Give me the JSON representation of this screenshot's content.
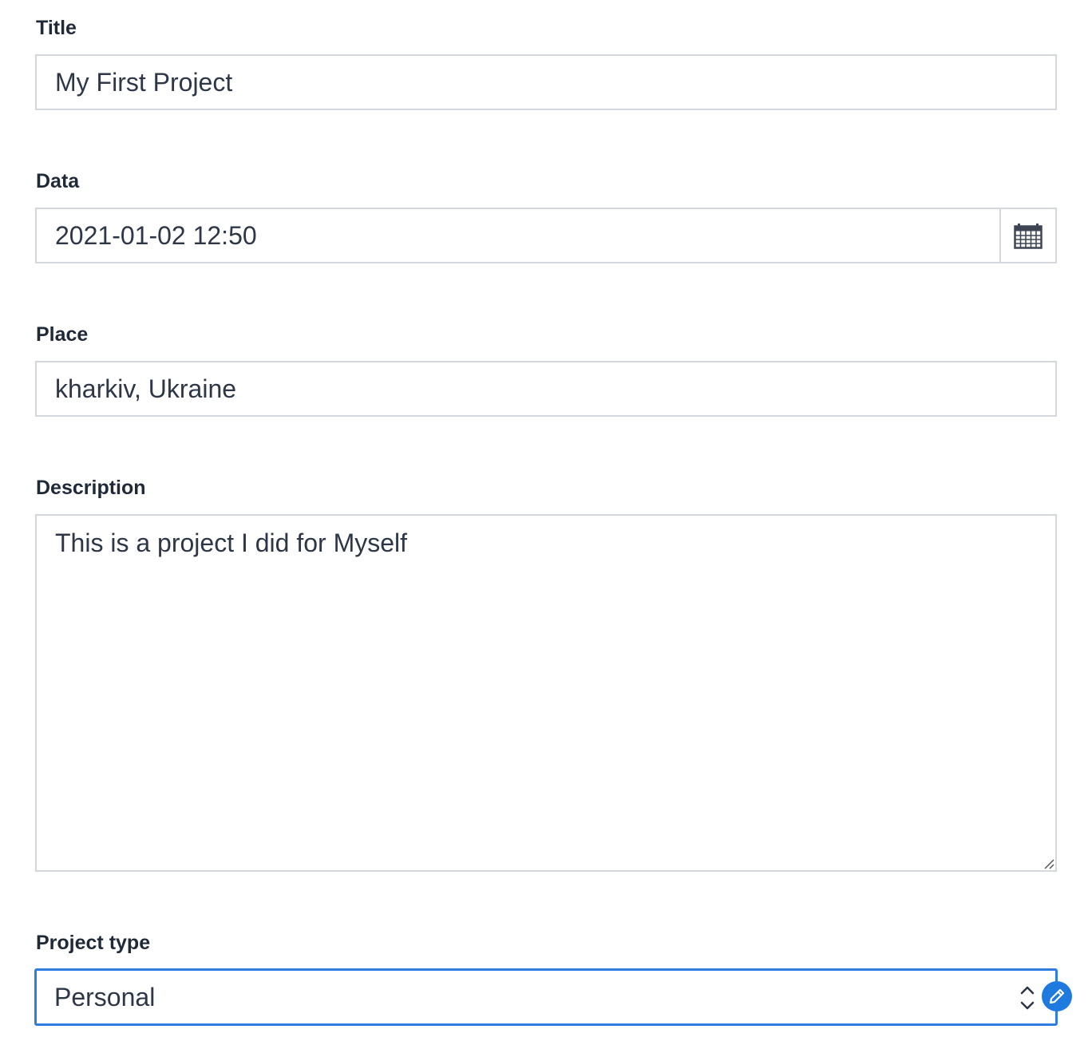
{
  "form": {
    "title": {
      "label": "Title",
      "value": "My First Project"
    },
    "date": {
      "label": "Data",
      "value": "2021-01-02 12:50",
      "icon": "calendar-icon"
    },
    "place": {
      "label": "Place",
      "value": "kharkiv, Ukraine"
    },
    "description": {
      "label": "Description",
      "value": "This is a project I did for Myself"
    },
    "project_type": {
      "label": "Project type",
      "value": "Personal",
      "icon": "select-arrows-icon"
    }
  },
  "edit_badge": {
    "icon": "pencil-icon"
  },
  "colors": {
    "focus_border": "#2f7de1",
    "badge": "#1f7ae0",
    "field_border": "#d4d7dc",
    "text": "#2d3748"
  }
}
